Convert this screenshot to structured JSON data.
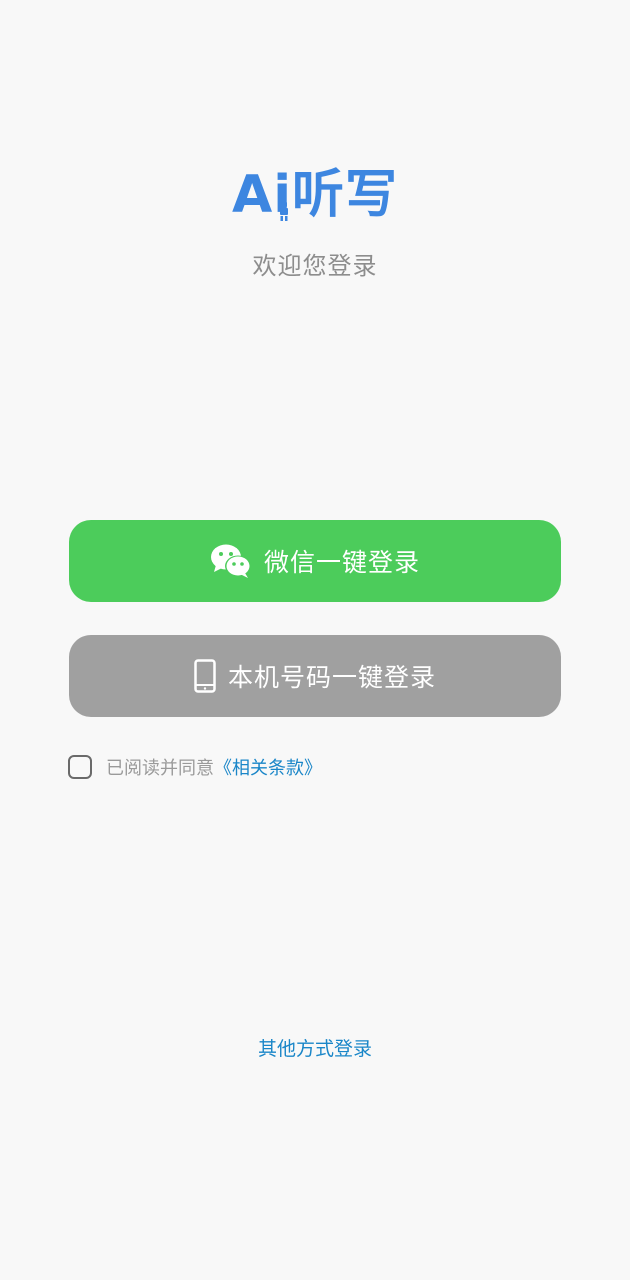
{
  "app": {
    "logo_text": "Ai听写",
    "welcome": "欢迎您登录"
  },
  "login": {
    "wechat_label": "微信一键登录",
    "phone_label": "本机号码一键登录",
    "agree_text": "已阅读并同意",
    "terms_link": "《相关条款》",
    "other_login": "其他方式登录"
  },
  "colors": {
    "wechat_green": "#4ccc5b",
    "phone_gray": "#a0a0a0",
    "link_blue": "#1a86c8",
    "logo_blue": "#3d86e0"
  }
}
